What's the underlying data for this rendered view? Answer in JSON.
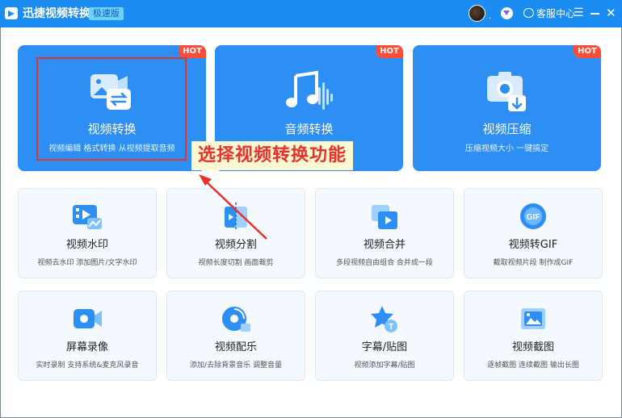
{
  "window": {
    "title": "迅捷视频转换器",
    "edition_badge": "极速版",
    "user_suffix": ".",
    "service_label": "客服中心",
    "menu_glyph": "☰",
    "close_glyph": "✕"
  },
  "feature_cards": [
    {
      "title": "视频转换",
      "subtitle": "视频编辑 格式转换 从视频提取音频",
      "badge": "HOT",
      "icon": "video-convert-icon"
    },
    {
      "title": "音频转换",
      "subtitle": "",
      "badge": "HOT",
      "icon": "audio-convert-icon"
    },
    {
      "title": "视频压缩",
      "subtitle": "压缩视频大小 一键搞定",
      "badge": "HOT",
      "icon": "video-compress-icon"
    }
  ],
  "tool_cards": [
    {
      "title": "视频水印",
      "subtitle": "视频去水印 添加图片/文字水印",
      "icon": "watermark-icon"
    },
    {
      "title": "视频分割",
      "subtitle": "视频长度切割 画面裁剪",
      "icon": "split-icon"
    },
    {
      "title": "视频合并",
      "subtitle": "多段视频自由组合 合并成一段",
      "icon": "merge-icon"
    },
    {
      "title": "视频转GIF",
      "subtitle": "截取视频片段 制作成GIF",
      "icon": "gif-icon"
    },
    {
      "title": "屏幕录像",
      "subtitle": "实时录制 支持系统&麦克风录音",
      "icon": "screen-record-icon"
    },
    {
      "title": "视频配乐",
      "subtitle": "添加/去除背景音乐 调整音量",
      "icon": "music-icon"
    },
    {
      "title": "字幕/贴图",
      "subtitle": "视频添加字幕/贴图",
      "icon": "subtitle-sticker-icon"
    },
    {
      "title": "视频截图",
      "subtitle": "逐帧截图 连续截图 输出长图",
      "icon": "screenshot-icon"
    }
  ],
  "annotation": {
    "text": "选择视频转换功能",
    "color": "#e8312a"
  },
  "colors": {
    "titlebar": "#1a8cf2",
    "card_blue": "#2d8ef4",
    "hot_badge": "#ff4d3a"
  }
}
